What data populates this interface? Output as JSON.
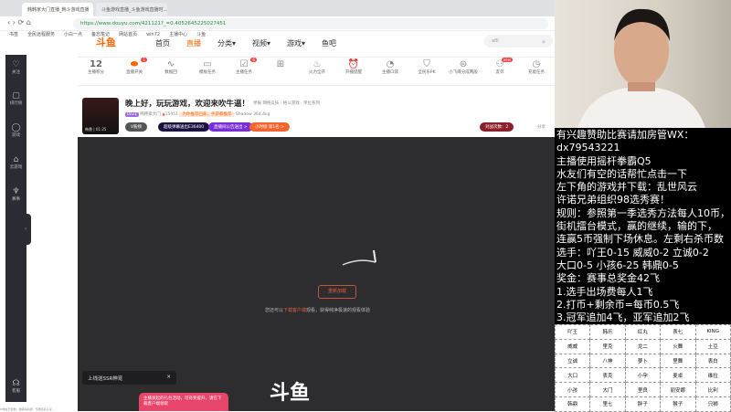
{
  "browser": {
    "tabs": [
      "韩韩家大门直播_韩斗游戏直播",
      "斗鱼游戏直播_斗鱼游戏直播时..."
    ],
    "url": "https://www.douyu.com/421121?_=0.4052645225027451",
    "bookmarks": [
      "书签",
      "全民远程服务",
      "小白一点",
      "备忘笔记",
      "网站首页",
      "win72",
      "主播中心",
      "斗鱼"
    ]
  },
  "site": {
    "logo": "斗鱼",
    "nav": [
      "首页",
      "直播",
      "分类▾",
      "视频▾",
      "游戏▾",
      "鱼吧"
    ],
    "search_placeholder": "afll"
  },
  "sidebar": [
    "关注",
    "排行榜",
    "游戏",
    "云游戏",
    "赛事",
    "客服"
  ],
  "toolbar": {
    "score": "12",
    "score_label": "主播积分",
    "items": [
      "直播开关",
      "数据回",
      "模板任务",
      "主播任务",
      "",
      "火力全开",
      "开播提醒",
      "主播口袋",
      "全民乐PK",
      "小飞碟分成两般",
      "友邻",
      "充能任务"
    ],
    "badges": [
      "1",
      "6",
      "new"
    ]
  },
  "room": {
    "title": "晚上好，玩玩游戏，欢迎来吹牛逼！",
    "report": "举报",
    "category": "网络竞技 · 格斗游戏 · 单位系列",
    "level": "LV21",
    "owner": "韩韩家大门",
    "hot": "15951",
    "promo": "为你推荐回家，手游都推荐",
    "shadow": "Shadow",
    "weight": "364.4kg",
    "pills": [
      "V粉榜",
      "超级弹幕送出E36400",
      "直播间公告送出 >",
      "小时榜 第1名 >"
    ],
    "gift": "对战次数：2",
    "share": "分享",
    "avatar_text": "韩鼎 | 01:25"
  },
  "player": {
    "refresh": "重新加载",
    "tip_pre": "您还可以",
    "tip_link": "下载客户端",
    "tip_post": "观看，获得纯净极速的观看体验",
    "watermark": "斗鱼",
    "toast1": "上线送SSR神宠",
    "toast2": "主播发起的礼包活动，可有奖提升，请在下载客户端领取"
  },
  "status_text": "IP地址已复制，撤销请右键，专属签名认证…",
  "panel_lines": [
    "有兴趣赞助比赛请加房管WX：",
    "dx79543221",
    "主播使用摇杆拳霸Q5",
    "水友们有空的话帮忙点击一下",
    "左下角的游戏并下载：乱世风云",
    "许诺兄弟组织98选秀赛！",
    "规则：参照第一季选秀方法每人10币，",
    "街机擂台模式，赢的继续，输的下，",
    "连赢5币强制下场休息。左剩右杀币数",
    "选手：吖王0-15 威威0-2 立诚0-2",
    "大口0-5 小孩6-25 韩鼎0-5",
    "奖金：赛事总奖金42飞",
    "1.选手出场费每人1飞",
    "2.打币+剩余币=每币0.5飞",
    "3.冠军追加4飞，亚军追加2飞"
  ],
  "roster": [
    [
      "吖王",
      "韩乐",
      "红丸",
      "表七",
      "KING"
    ],
    [
      "威威",
      "里克",
      "龙二",
      "火舞",
      "土豆"
    ],
    [
      "立诚",
      "八神",
      "萝卜",
      "里舞",
      "表白"
    ],
    [
      "大口",
      "表克",
      "小孕",
      "麦卓",
      "维拉"
    ],
    [
      "小孩",
      "大门",
      "里良",
      "丽安娜",
      "比利"
    ],
    [
      "韩鼎",
      "里七",
      "胖子",
      "猴子",
      "只狮"
    ]
  ]
}
